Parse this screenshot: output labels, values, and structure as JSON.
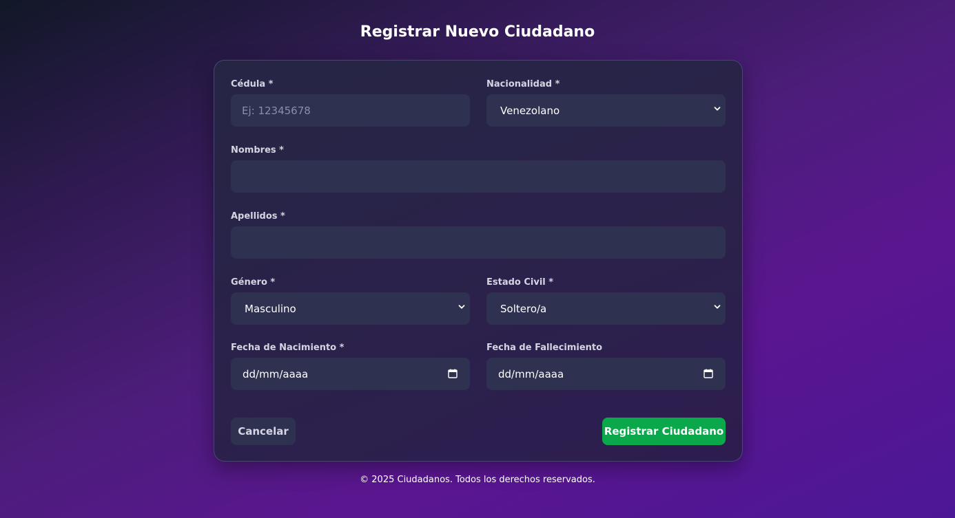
{
  "page": {
    "title": "Registrar Nuevo Ciudadano",
    "footer": "© 2025 Ciudadanos. Todos los derechos reservados."
  },
  "form": {
    "cedula": {
      "label": "Cédula *",
      "placeholder": "Ej: 12345678",
      "value": ""
    },
    "nacionalidad": {
      "label": "Nacionalidad *",
      "selected": "Venezolano"
    },
    "nombres": {
      "label": "Nombres *",
      "value": ""
    },
    "apellidos": {
      "label": "Apellidos *",
      "value": ""
    },
    "genero": {
      "label": "Género *",
      "selected": "Masculino"
    },
    "estado_civil": {
      "label": "Estado Civil *",
      "selected": "Soltero/a"
    },
    "fecha_nacimiento": {
      "label": "Fecha de Nacimiento *",
      "value": "dd/mm/aaaa"
    },
    "fecha_fallecimiento": {
      "label": "Fecha de Fallecimiento",
      "value": "dd/mm/aaaa"
    }
  },
  "actions": {
    "cancel_label": "Cancelar",
    "submit_label": "Registrar Ciudadano"
  },
  "icons": {
    "select": "chevron-down-icon",
    "date": "calendar-icon"
  },
  "colors": {
    "submit": "#0aa84a",
    "input_bg": "#2e3150",
    "background_accent": "#5a1690"
  }
}
